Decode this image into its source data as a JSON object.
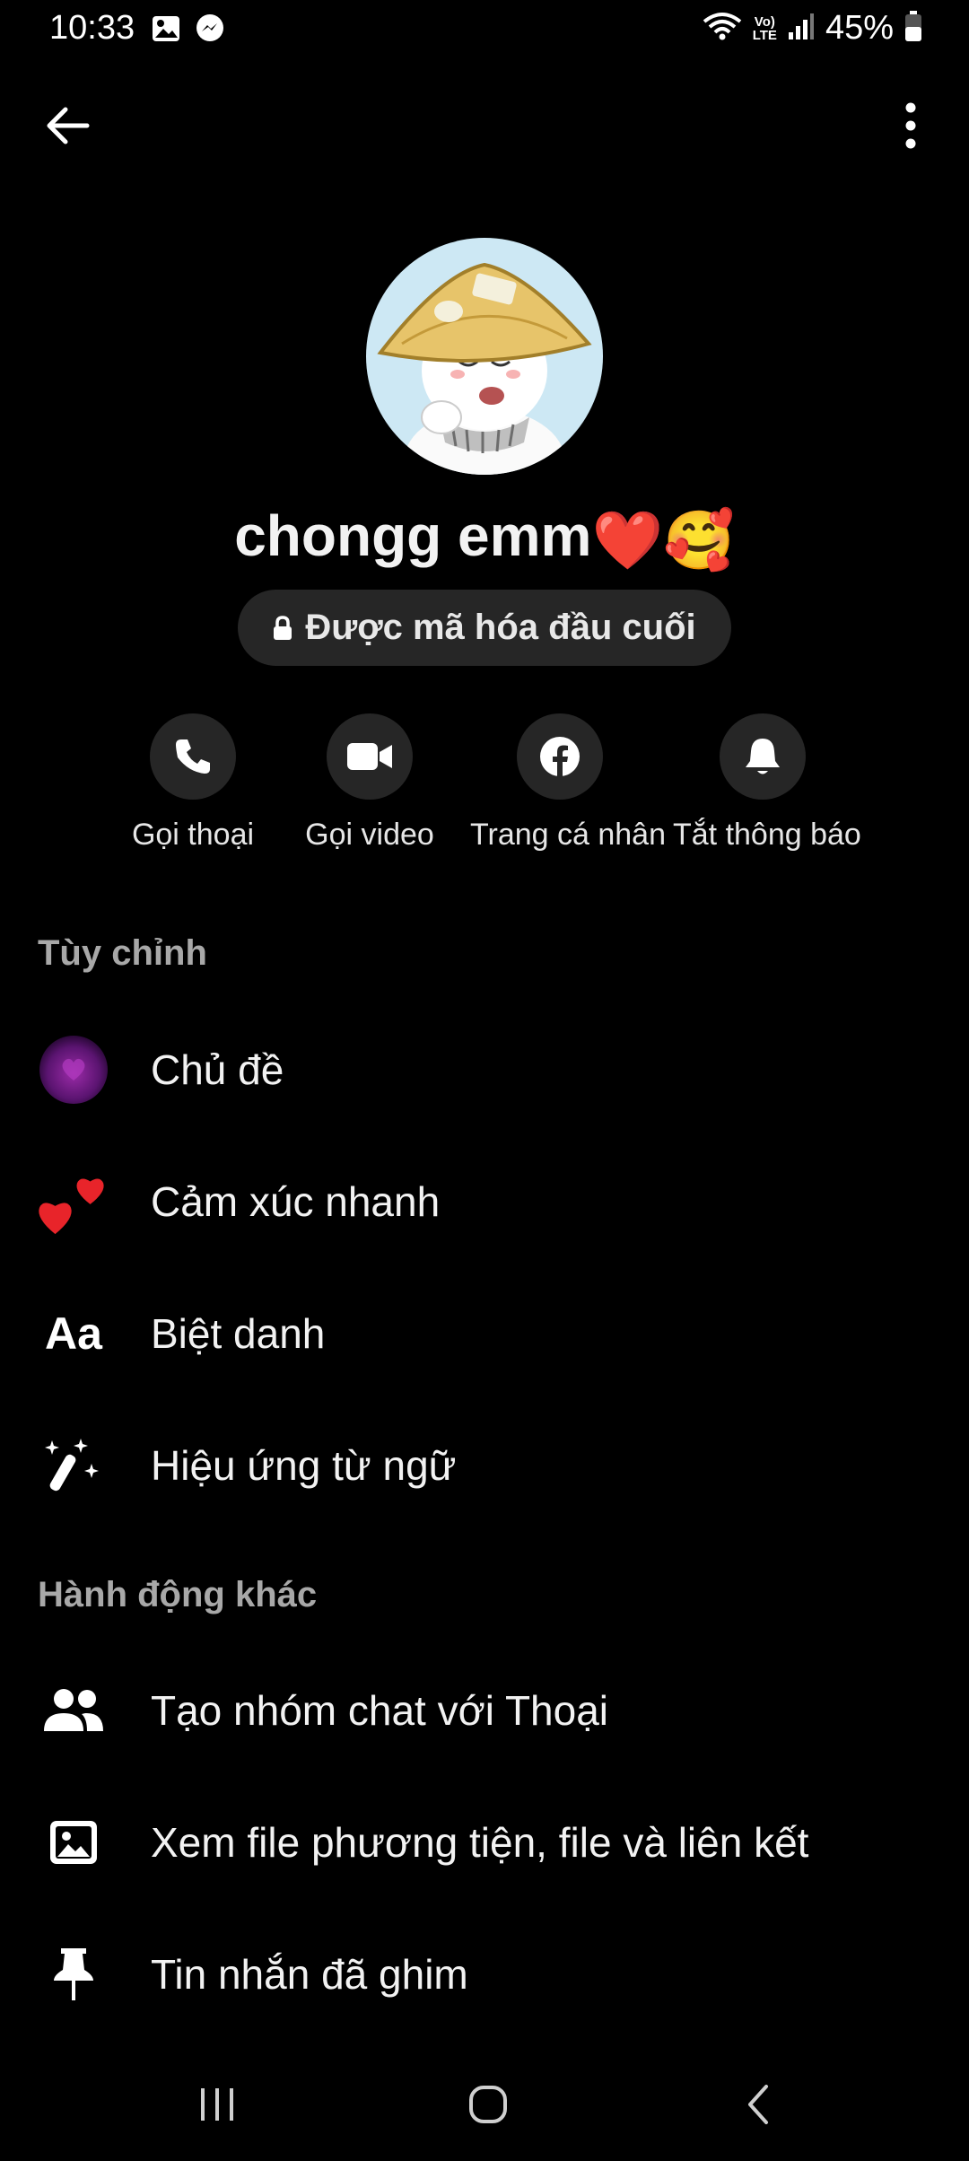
{
  "status_bar": {
    "time": "10:33",
    "battery": "45%",
    "volte_top": "Vo)",
    "volte_bottom": "LTE"
  },
  "profile": {
    "name": "chongg emm",
    "name_emojis": "❤️🥰",
    "encryption_label": "Được mã hóa đầu cuối"
  },
  "actions": [
    {
      "label": "Gọi thoại",
      "icon": "phone-icon"
    },
    {
      "label": "Gọi video",
      "icon": "video-icon"
    },
    {
      "label": "Trang cá nhân",
      "icon": "facebook-icon"
    },
    {
      "label": "Tắt thông báo",
      "icon": "bell-icon"
    }
  ],
  "sections": {
    "customize": {
      "title": "Tùy chỉnh",
      "items": [
        {
          "label": "Chủ đề",
          "icon": "theme-icon"
        },
        {
          "label": "Cảm xúc nhanh",
          "icon": "hearts-icon"
        },
        {
          "label": "Biệt danh",
          "icon": "nickname-icon",
          "glyph": "Aa"
        },
        {
          "label": "Hiệu ứng từ ngữ",
          "icon": "magic-wand-icon"
        }
      ]
    },
    "other": {
      "title": "Hành động khác",
      "items": [
        {
          "label": "Tạo nhóm chat với Thoại",
          "icon": "group-icon"
        },
        {
          "label": "Xem file phương tiện, file và liên kết",
          "icon": "image-icon"
        },
        {
          "label": "Tin nhắn đã ghim",
          "icon": "pin-icon"
        }
      ]
    }
  },
  "colors": {
    "background": "#000000",
    "surface": "#262626",
    "text": "#f2f2f2",
    "muted": "#a8a8a8"
  }
}
